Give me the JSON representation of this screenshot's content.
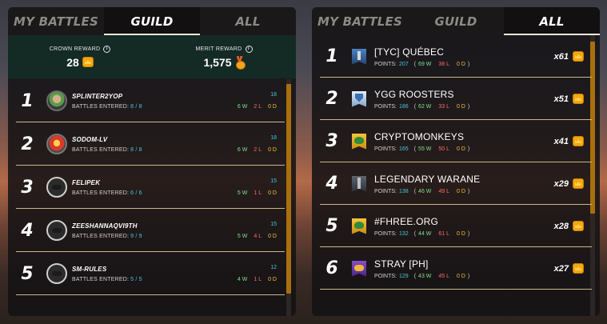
{
  "left_panel": {
    "tabs": [
      {
        "label": "MY BATTLES",
        "active": false
      },
      {
        "label": "GUILD",
        "active": true
      },
      {
        "label": "ALL",
        "active": false
      }
    ],
    "crown_reward": {
      "label": "CROWN REWARD",
      "value": "28",
      "icon": "crown-coin-icon"
    },
    "merit_reward": {
      "label": "MERIT REWARD",
      "value": "1,575",
      "icon": "merit-medal-icon"
    },
    "battles_label": "BATTLES ENTERED:",
    "players": [
      {
        "rank": "1",
        "name": "SPLINTER2YOP",
        "battles": "8 / 8",
        "top": "18",
        "w": "6 W",
        "l": "2 L",
        "d": "0 D",
        "avatar": "green-summoner-avatar"
      },
      {
        "rank": "2",
        "name": "SODOM-LV",
        "battles": "8 / 8",
        "top": "18",
        "w": "6 W",
        "l": "2 L",
        "d": "0 D",
        "avatar": "fire-summoner-avatar"
      },
      {
        "rank": "3",
        "name": "FELIPEK",
        "battles": "6 / 6",
        "top": "15",
        "w": "5 W",
        "l": "1 L",
        "d": "0 D",
        "avatar": "mask-avatar"
      },
      {
        "rank": "4",
        "name": "ZEESHANNAQVI9TH",
        "battles": "9 / 9",
        "top": "15",
        "w": "5 W",
        "l": "4 L",
        "d": "0 D",
        "avatar": "mask-avatar"
      },
      {
        "rank": "5",
        "name": "SM-RULES",
        "battles": "5 / 5",
        "top": "12",
        "w": "4 W",
        "l": "1 L",
        "d": "0 D",
        "avatar": "mask-avatar"
      }
    ]
  },
  "right_panel": {
    "tabs": [
      {
        "label": "MY BATTLES",
        "active": false
      },
      {
        "label": "GUILD",
        "active": false
      },
      {
        "label": "ALL",
        "active": true
      }
    ],
    "points_label": "POINTS:",
    "guilds": [
      {
        "rank": "1",
        "name": "[TYC] QUÉBEC",
        "points": "207",
        "w": "69 W",
        "l": "38 L",
        "d": "0 D",
        "multiplier": "x61",
        "banner": "blue-banner"
      },
      {
        "rank": "2",
        "name": "YGG ROOSTERS",
        "points": "186",
        "w": "62 W",
        "l": "33 L",
        "d": "0 D",
        "multiplier": "x51",
        "banner": "shield-banner"
      },
      {
        "rank": "3",
        "name": "CRYPTOMONKEYS",
        "points": "165",
        "w": "55 W",
        "l": "50 L",
        "d": "0 D",
        "multiplier": "x41",
        "banner": "gold-banner"
      },
      {
        "rank": "4",
        "name": "LEGENDARY WARANE",
        "points": "138",
        "w": "46 W",
        "l": "49 L",
        "d": "0 D",
        "multiplier": "x29",
        "banner": "dark-banner"
      },
      {
        "rank": "5",
        "name": "#FHREE.ORG",
        "points": "132",
        "w": "44 W",
        "l": "61 L",
        "d": "0 D",
        "multiplier": "x28",
        "banner": "gold-banner"
      },
      {
        "rank": "6",
        "name": "STRAY [PH]",
        "points": "129",
        "w": "43 W",
        "l": "45 L",
        "d": "0 D",
        "multiplier": "x27",
        "banner": "purple-banner"
      }
    ]
  },
  "colors": {
    "accent_gold": "#a86f0e",
    "win": "#7fe08a",
    "loss": "#ff6b6b",
    "draw": "#f4c040",
    "points": "#43c6d8",
    "reward_bar": "#132a25"
  }
}
